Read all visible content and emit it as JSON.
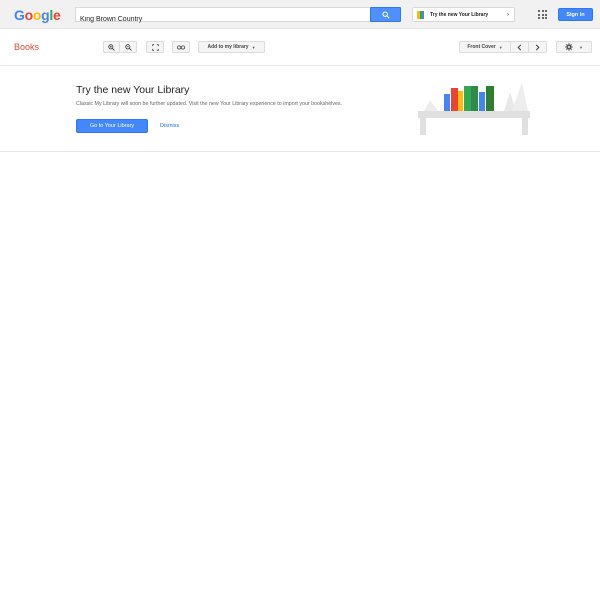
{
  "header": {
    "logo": [
      {
        "ch": "G",
        "color": "#4285f4"
      },
      {
        "ch": "o",
        "color": "#ea4335"
      },
      {
        "ch": "o",
        "color": "#fbbc05"
      },
      {
        "ch": "g",
        "color": "#4285f4"
      },
      {
        "ch": "l",
        "color": "#34a853"
      },
      {
        "ch": "e",
        "color": "#ea4335"
      }
    ],
    "search_value": "King Brown Country",
    "search_icon": "search-icon",
    "try_library_label": "Try the new Your Library",
    "apps_icon": "apps-grid-icon",
    "signin_label": "Sign in"
  },
  "toolbar": {
    "section_title": "Books",
    "zoom_in_icon": "zoom-in-icon",
    "zoom_out_icon": "zoom-out-icon",
    "fullscreen_icon": "fullscreen-icon",
    "link_icon": "link-icon",
    "add_to_library_label": "Add to my library",
    "front_cover_label": "Front Cover",
    "settings_icon": "gear-icon"
  },
  "promo": {
    "title": "Try the new Your Library",
    "text": "Classic My Library will soon be further updated. Visit the new Your Library experience to import your bookshelves.",
    "goto_label": "Go to Your Library",
    "dismiss_label": "Dismiss"
  },
  "colors": {
    "accent_blue": "#4387fd",
    "books_red": "#dd4b39",
    "link_blue": "#1a73e8"
  }
}
